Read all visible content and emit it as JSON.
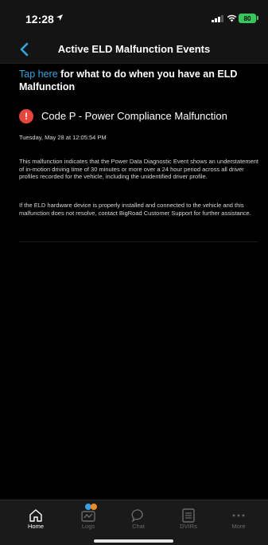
{
  "status_bar": {
    "time": "12:28",
    "battery": "80"
  },
  "nav": {
    "title": "Active ELD Malfunction Events"
  },
  "help": {
    "link_text": "Tap here",
    "rest_text": " for what to do when you have an ELD Malfunction"
  },
  "event": {
    "title": "Code P - Power Compliance Malfunction",
    "timestamp": "Tuesday, May 28 at 12:05:54 PM",
    "description": "This malfunction indicates that the Power Data Diagnostic Event shows an understatement of in-motion driving time of 30 minutes or more over a 24 hour period across all driver profiles recorded for the vehicle, including the unidentified driver profile.",
    "instructions": "If the ELD hardware device is properly installed and connected to the vehicle and this malfunction does not resolve, contact BigRoad Customer Support for further assistance."
  },
  "tabs": [
    {
      "label": "Home",
      "icon": "home-icon",
      "active": true
    },
    {
      "label": "Logs",
      "icon": "logs-icon",
      "active": false
    },
    {
      "label": "Chat",
      "icon": "chat-icon",
      "active": false
    },
    {
      "label": "DVIRs",
      "icon": "dvir-icon",
      "active": false
    },
    {
      "label": "More",
      "icon": "more-icon",
      "active": false
    }
  ],
  "colors": {
    "accent": "#2fa8e0",
    "alert": "#e8453c",
    "battery": "#34c759"
  }
}
